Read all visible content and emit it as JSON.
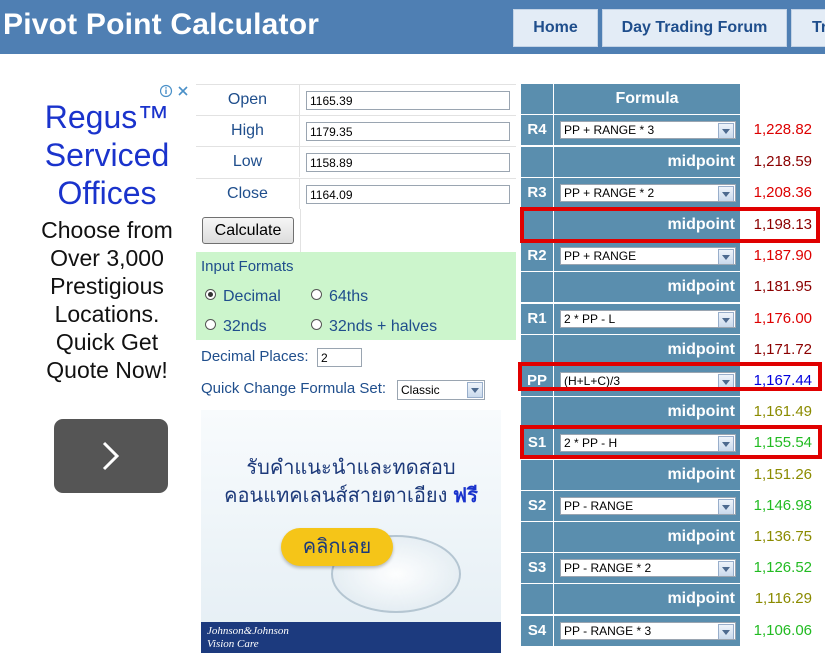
{
  "header": {
    "title": "Pivot Point Calculator",
    "nav": [
      "Home",
      "Day Trading Forum",
      "Tr"
    ]
  },
  "ad_left": {
    "title": "Regus™ Serviced Offices",
    "body": "Choose from Over 3,000 Prestigious Locations. Quick Get Quote Now!",
    "title_color": "#1a33cc"
  },
  "calculator": {
    "fields": [
      {
        "label": "Open",
        "value": "1165.39"
      },
      {
        "label": "High",
        "value": "1179.35"
      },
      {
        "label": "Low",
        "value": "1158.89"
      },
      {
        "label": "Close",
        "value": "1164.09"
      }
    ],
    "calculate_label": "Calculate",
    "formats_title": "Input Formats",
    "formats": [
      {
        "label": "Decimal",
        "checked": true
      },
      {
        "label": "64ths",
        "checked": false
      },
      {
        "label": "32nds",
        "checked": false
      },
      {
        "label": "32nds + halves",
        "checked": false
      }
    ],
    "decimal_places_label": "Decimal Places:",
    "decimal_places_value": "2",
    "formula_set_label": "Quick Change Formula Set:",
    "formula_set_value": "Classic"
  },
  "ad_contact": {
    "headline_line1": "รับคำแนะนำและทดสอบ",
    "headline_line2": "คอนแทคเลนส์สายตาเอียง",
    "headline_free": "ฟรี",
    "cta": "คลิกเลย",
    "brand_line1": "Johnson&Johnson",
    "brand_line2": "Vision Care"
  },
  "pivot": {
    "header": "Formula",
    "midpoint_label": "midpoint",
    "colors": {
      "resistance": "#dd0000",
      "resistance_mid": "#8b0000",
      "pivot": "#0000dd",
      "support_mid": "#8b8b00",
      "support": "#22bb22",
      "header_bg": "#5a8eae",
      "highlight": "#e00000"
    },
    "rows": [
      {
        "kind": "level",
        "label": "R4",
        "formula": "PP + RANGE * 3",
        "value": "1,228.82",
        "color": "resistance"
      },
      {
        "kind": "mid",
        "value": "1,218.59",
        "color": "resistance_mid"
      },
      {
        "kind": "level",
        "label": "R3",
        "formula": "PP + RANGE * 2",
        "value": "1,208.36",
        "color": "resistance"
      },
      {
        "kind": "mid",
        "value": "1,198.13",
        "color": "resistance_mid"
      },
      {
        "kind": "level",
        "label": "R2",
        "formula": "PP + RANGE",
        "value": "1,187.90",
        "color": "resistance"
      },
      {
        "kind": "mid",
        "value": "1,181.95",
        "color": "resistance_mid"
      },
      {
        "kind": "level",
        "label": "R1",
        "formula": "2 * PP - L",
        "value": "1,176.00",
        "color": "resistance"
      },
      {
        "kind": "mid",
        "value": "1,171.72",
        "color": "resistance_mid"
      },
      {
        "kind": "level",
        "label": "PP",
        "formula": "(H+L+C)/3",
        "value": "1,167.44",
        "color": "pivot"
      },
      {
        "kind": "mid",
        "value": "1,161.49",
        "color": "support_mid"
      },
      {
        "kind": "level",
        "label": "S1",
        "formula": "2 * PP - H",
        "value": "1,155.54",
        "color": "support"
      },
      {
        "kind": "mid",
        "value": "1,151.26",
        "color": "support_mid"
      },
      {
        "kind": "level",
        "label": "S2",
        "formula": "PP - RANGE",
        "value": "1,146.98",
        "color": "support"
      },
      {
        "kind": "mid",
        "value": "1,136.75",
        "color": "support_mid"
      },
      {
        "kind": "level",
        "label": "S3",
        "formula": "PP - RANGE * 2",
        "value": "1,126.52",
        "color": "support"
      },
      {
        "kind": "mid",
        "value": "1,116.29",
        "color": "support_mid"
      },
      {
        "kind": "level",
        "label": "S4",
        "formula": "PP - RANGE * 3",
        "value": "1,106.06",
        "color": "support"
      }
    ]
  }
}
